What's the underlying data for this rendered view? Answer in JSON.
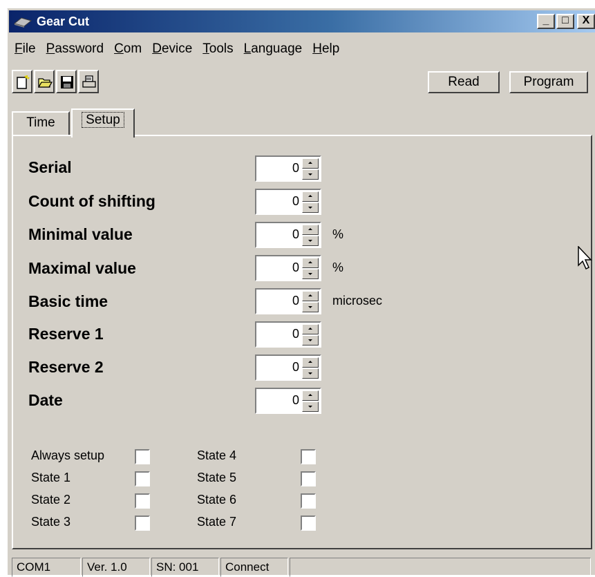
{
  "window": {
    "title": "Gear Cut",
    "min_label": "_",
    "max_label": "□",
    "close_label": "X"
  },
  "menu": [
    {
      "pre": "",
      "ul": "F",
      "post": "ile"
    },
    {
      "pre": "",
      "ul": "P",
      "post": "assword"
    },
    {
      "pre": "",
      "ul": "C",
      "post": "om"
    },
    {
      "pre": "",
      "ul": "D",
      "post": "evice"
    },
    {
      "pre": "",
      "ul": "T",
      "post": "ools"
    },
    {
      "pre": "",
      "ul": "L",
      "post": "anguage"
    },
    {
      "pre": "",
      "ul": "H",
      "post": "elp"
    }
  ],
  "toolbar": {
    "icons": [
      "new-file-icon",
      "open-folder-icon",
      "save-icon",
      "print-icon"
    ],
    "read_label": "Read",
    "program_label": "Program"
  },
  "tabs": [
    {
      "label": "Time"
    },
    {
      "label": "Setup"
    }
  ],
  "fields": [
    {
      "label": "Serial",
      "value": "0",
      "unit": ""
    },
    {
      "label": "Count of shifting",
      "value": "0",
      "unit": ""
    },
    {
      "label": "Minimal value",
      "value": "0",
      "unit": "%"
    },
    {
      "label": "Maximal value",
      "value": "0",
      "unit": "%"
    },
    {
      "label": "Basic time",
      "value": "0",
      "unit": "microsec"
    },
    {
      "label": "Reserve 1",
      "value": "0",
      "unit": ""
    },
    {
      "label": "Reserve 2",
      "value": "0",
      "unit": ""
    },
    {
      "label": "Date",
      "value": "0",
      "unit": ""
    }
  ],
  "checkboxes_left": [
    {
      "label": "Always setup",
      "checked": false
    },
    {
      "label": "State 1",
      "checked": false
    },
    {
      "label": "State 2",
      "checked": false
    },
    {
      "label": "State 3",
      "checked": false
    }
  ],
  "checkboxes_right": [
    {
      "label": "State 4",
      "checked": false
    },
    {
      "label": "State 5",
      "checked": false
    },
    {
      "label": "State 6",
      "checked": false
    },
    {
      "label": "State 7",
      "checked": false
    }
  ],
  "status": {
    "port": "COM1",
    "version": "Ver. 1.0",
    "serial": "SN: 001",
    "state": "Connect"
  }
}
